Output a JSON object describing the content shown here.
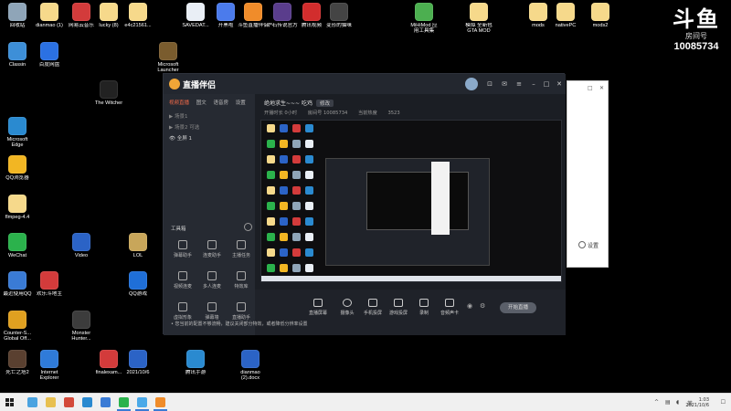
{
  "watermark": {
    "logo": "斗鱼",
    "label": "房间号",
    "room_id": "10085734"
  },
  "desktop_icons": [
    {
      "label": "回收站",
      "color": "#8fa5b8"
    },
    {
      "label": "dianmao (1)",
      "color": "#f6d98b"
    },
    {
      "label": "网易云音乐",
      "color": "#d33b3b"
    },
    {
      "label": "lucky (8)",
      "color": "#f6d98b"
    },
    {
      "label": "e4c21561...",
      "color": "#f6d98b"
    },
    {
      "label": "SAVEDAT...",
      "color": "#e9eef5"
    },
    {
      "label": "开黑啦",
      "color": "#4b7bec"
    },
    {
      "label": "斗鱼直播伴侣",
      "color": "#f08c2a"
    },
    {
      "label": "炉石传说官方",
      "color": "#5a3d8c"
    },
    {
      "label": "腾讯视频",
      "color": "#d22d2d"
    },
    {
      "label": "变形的猫咪",
      "color": "#444"
    },
    {
      "label": "Classin",
      "color": "#3d8fd8"
    },
    {
      "label": "百度网盘",
      "color": "#2b71e3"
    },
    {
      "label": "Microsoft Edge",
      "color": "#2a8ad0"
    },
    {
      "label": "QQ浏览器",
      "color": "#f2b623"
    },
    {
      "label": "flmpeg-4.4",
      "color": "#f6d98b"
    },
    {
      "label": "WeChat",
      "color": "#2bb24c"
    },
    {
      "label": "最近使用QQ",
      "color": "#3a7bd5"
    },
    {
      "label": "Counter-S... Global Off...",
      "color": "#e0a020"
    },
    {
      "label": "死亡之塔2",
      "color": "#5a4030"
    },
    {
      "label": "Internet Explorer",
      "color": "#2f7bd9"
    },
    {
      "label": "Microsoft Launcher",
      "color": "#7a5c2e"
    },
    {
      "label": "The Witcher",
      "color": "#222"
    },
    {
      "label": "LOL",
      "color": "#c8a65a"
    },
    {
      "label": "Monster Hunter...",
      "color": "#3c3c3c"
    },
    {
      "label": "finalexam...",
      "color": "#d33b3b"
    },
    {
      "label": "dianmao (2).docx",
      "color": "#2b63c6"
    },
    {
      "label": "腾讯手游",
      "color": "#2a8ad0"
    },
    {
      "label": "MiHiMod 应用工具集",
      "color": "#4caf50"
    },
    {
      "label": "模拟 全新包 GTA MOD",
      "color": "#f6d98b"
    },
    {
      "label": "mods",
      "color": "#f6d98b"
    },
    {
      "label": "nativePC",
      "color": "#f6d98b"
    },
    {
      "label": "mods2",
      "color": "#f6d98b"
    },
    {
      "label": "2021/10/6",
      "color": "#2b63c6"
    },
    {
      "label": "欢乐斗地主",
      "color": "#d33b3b"
    },
    {
      "label": "QQ游戏",
      "color": "#1f6fd8"
    },
    {
      "label": "Video",
      "color": "#2b63c6"
    }
  ],
  "app": {
    "brand": "直播伴侣",
    "side_tabs": [
      "视频直播",
      "图文",
      "语音房",
      "设置"
    ],
    "scenes": [
      "▶ 场景1",
      "▶ 场景2 可选",
      "👁 全屏 1"
    ],
    "toolbox_label": "工具箱",
    "tools": [
      "弹幕助手",
      "连麦助手",
      "主播任务",
      "视频连麦",
      "多人连麦",
      "特效库",
      "虚拟形象",
      "弹幕墙",
      "直播助手"
    ],
    "room_title": "绝地求生~~~ 吃鸡",
    "edit_label": "修改",
    "meta": [
      "开播时长 0小时",
      "房间号 10085734",
      "当前热度",
      "3523"
    ],
    "bottom_items": [
      "直播屏幕",
      "摄像头",
      "手机投屏",
      "游戏投屏",
      "录制",
      "音频声卡"
    ],
    "start_live": "开始直播",
    "warning": "• 您当前的配置不够流畅，建议关闭部分特效，或者降低分辨率设置"
  },
  "bgwin": {
    "setting_label": "设置"
  },
  "taskbar": {
    "time": "1:03",
    "date": "2021/10/6"
  }
}
